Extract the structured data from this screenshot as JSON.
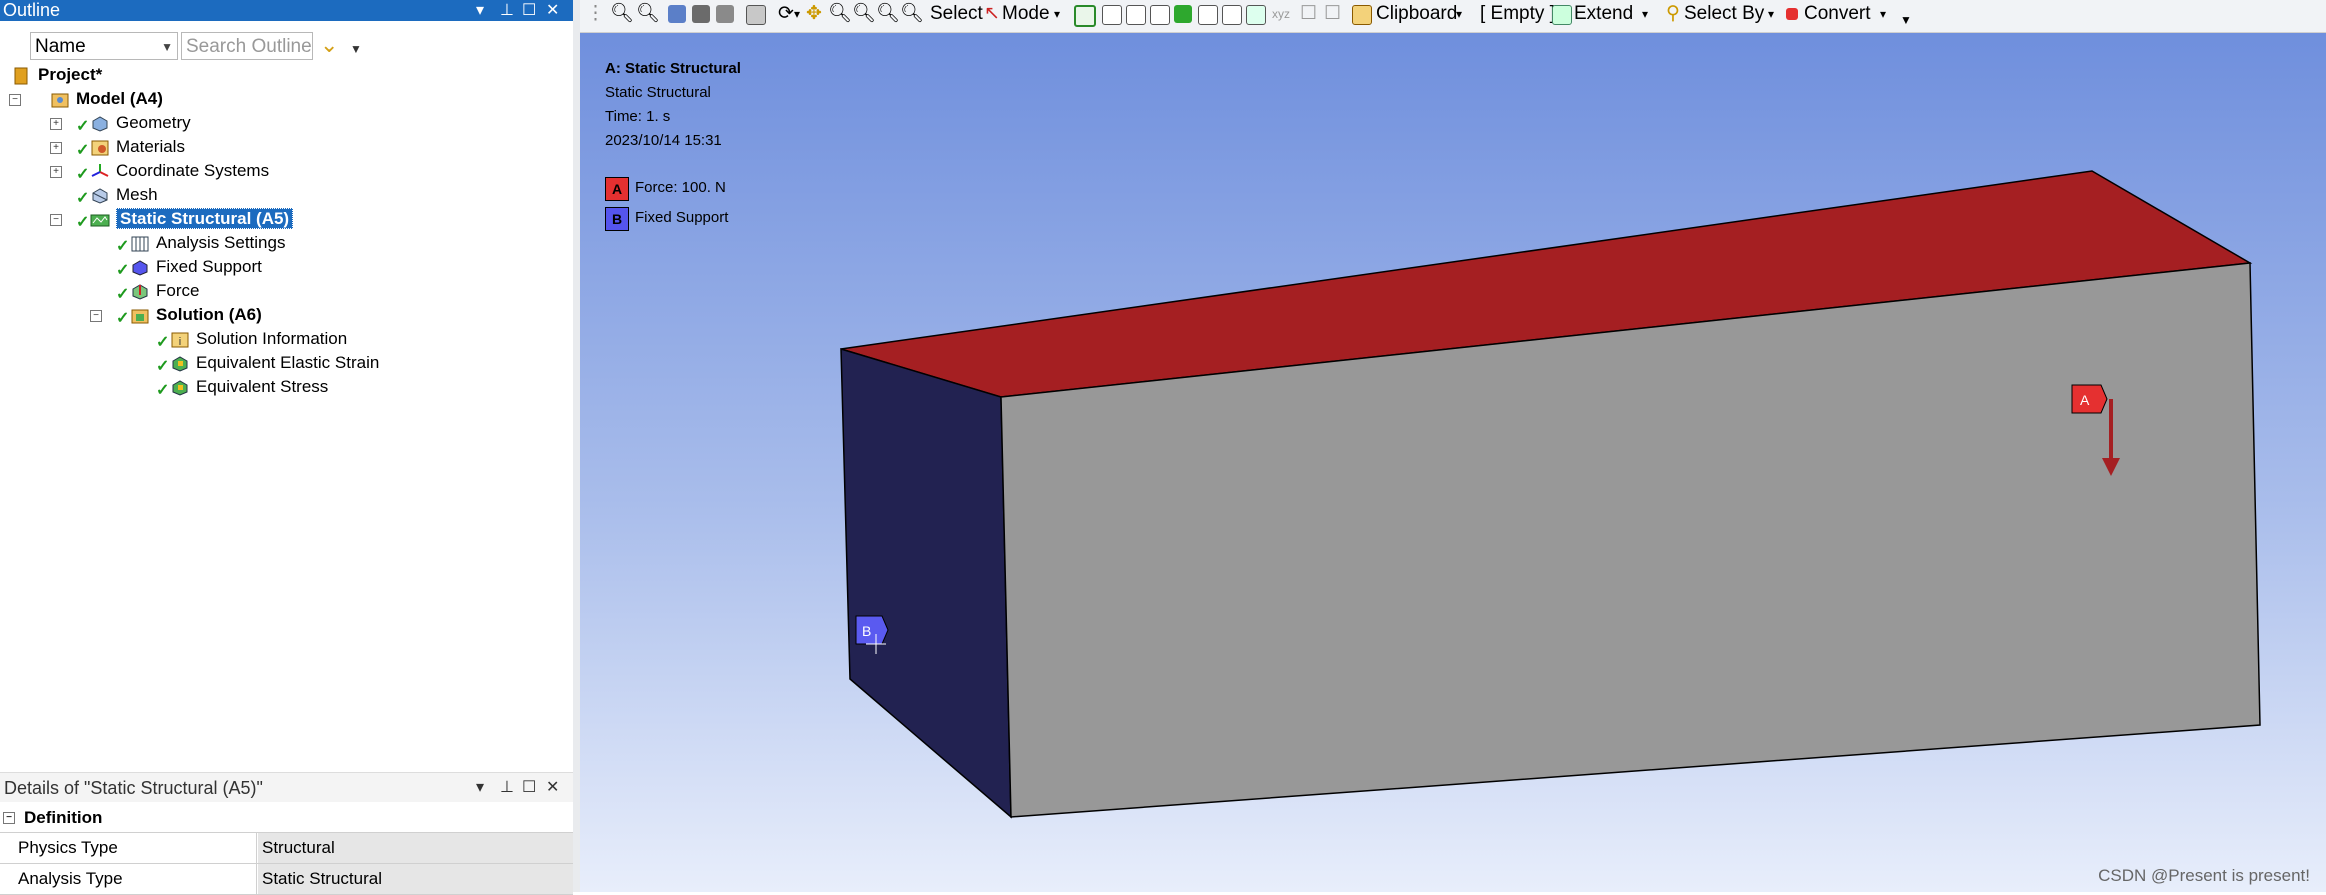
{
  "outline": {
    "title": "Outline",
    "name_filter": "Name",
    "search_placeholder": "Search Outline",
    "tree": [
      {
        "label": "Project*"
      },
      {
        "label": "Model (A4)"
      },
      {
        "label": "Geometry"
      },
      {
        "label": "Materials"
      },
      {
        "label": "Coordinate Systems"
      },
      {
        "label": "Mesh"
      },
      {
        "label": "Static Structural (A5)"
      },
      {
        "label": "Analysis Settings"
      },
      {
        "label": "Fixed Support"
      },
      {
        "label": "Force"
      },
      {
        "label": "Solution (A6)"
      },
      {
        "label": "Solution Information"
      },
      {
        "label": "Equivalent Elastic Strain"
      },
      {
        "label": "Equivalent Stress"
      }
    ]
  },
  "details": {
    "title": "Details of \"Static Structural (A5)\"",
    "section": "Definition",
    "rows": [
      {
        "key": "Physics Type",
        "value": "Structural"
      },
      {
        "key": "Analysis Type",
        "value": "Static Structural"
      }
    ]
  },
  "toolbar": {
    "select_label": "Select",
    "mode_label": "Mode",
    "clipboard_label": "Clipboard",
    "empty_label": "[ Empty ]",
    "extend_label": "Extend",
    "select_by_label": "Select By",
    "convert_label": "Convert"
  },
  "viewport": {
    "title_line": "A: Static Structural",
    "subtitle": "Static Structural",
    "time": "Time: 1. s",
    "date": "2023/10/14 15:31",
    "legend": [
      {
        "letter": "A",
        "label": "Force: 100. N",
        "color": "#e53030"
      },
      {
        "letter": "B",
        "label": "Fixed Support",
        "color": "#5555ee"
      }
    ],
    "marker_a": "A",
    "marker_b": "B",
    "watermark": "CSDN @Present is present!"
  },
  "colors": {
    "accent": "#1c6bbf",
    "top_face": "#a51f22",
    "side_face": "#222251",
    "front_face": "#989898"
  }
}
